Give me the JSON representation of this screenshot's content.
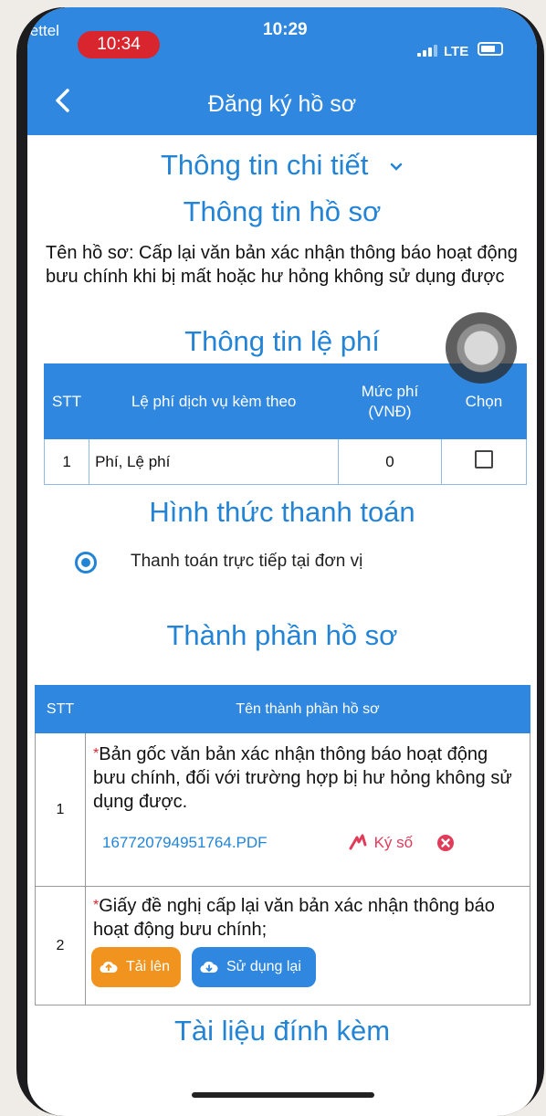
{
  "status_bar": {
    "carrier": "Viettel",
    "carrier_network": "LTE",
    "call_timer": "10:34",
    "time": "10:29",
    "network": "LTE",
    "battery": "64%"
  },
  "nav": {
    "title": "Đăng ký hồ sơ",
    "back_icon": "chevron-left-icon"
  },
  "sections": {
    "details_heading": "Thông tin chi tiết",
    "profile_heading": "Thông tin hồ sơ",
    "profile_name": "Tên hồ sơ: Cấp lại văn bản xác nhận thông báo hoạt động bưu chính khi bị mất hoặc hư hỏng không sử dụng được",
    "fee_heading": "Thông tin lệ phí",
    "payment_heading": "Hình thức thanh toán",
    "components_heading": "Thành phần hồ sơ",
    "attachments_heading": "Tài liệu đính kèm"
  },
  "fee_table": {
    "headers": [
      "STT",
      "Lệ phí dịch vụ kèm theo",
      "Mức phí (VNĐ)",
      "Chọn"
    ],
    "rows": [
      {
        "stt": "1",
        "name": "Phí, Lệ phí",
        "amount": "0",
        "selected": false
      }
    ]
  },
  "payment": {
    "option_label": "Thanh toán trực tiếp tại đơn vị",
    "selected": true
  },
  "components_table": {
    "headers": [
      "STT",
      "Tên thành phần hồ sơ"
    ],
    "rows": [
      {
        "stt": "1",
        "required_mark": "*",
        "name": "Bản gốc văn bản xác nhận thông báo hoạt động bưu chính, đối với trường hợp bị hư hỏng không sử dụng được.",
        "file": "167720794951764.PDF",
        "sign_label": "Ký số"
      },
      {
        "stt": "2",
        "required_mark": "*",
        "name": "Giấy đề nghị cấp lại văn bản xác nhận thông báo hoạt động bưu chính;",
        "upload_label": "Tải lên",
        "reuse_label": "Sử dụng lại"
      }
    ]
  },
  "colors": {
    "primary": "#2f87df",
    "heading": "#2384d6",
    "upload_button": "#f0941f",
    "reuse_button": "#2f87df",
    "danger": "#d9262e"
  }
}
